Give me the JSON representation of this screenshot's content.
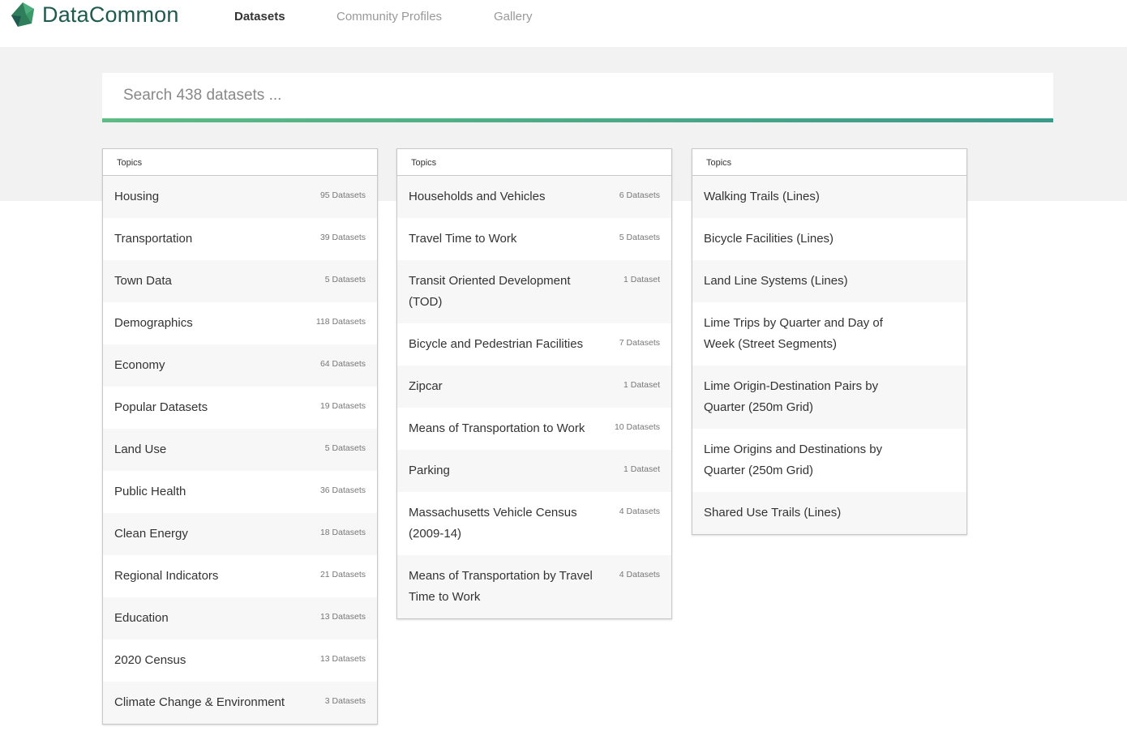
{
  "brand": {
    "name": "DataCommon",
    "colors": {
      "primary": "#1f5a4e",
      "accent": "#5cbc84"
    }
  },
  "nav": [
    {
      "label": "Datasets",
      "active": true
    },
    {
      "label": "Community Profiles",
      "active": false
    },
    {
      "label": "Gallery",
      "active": false
    }
  ],
  "search": {
    "placeholder": "Search 438 datasets ...",
    "value": ""
  },
  "panels": [
    {
      "header": "Topics",
      "items": [
        {
          "label": "Housing",
          "count": "95 Datasets"
        },
        {
          "label": "Transportation",
          "count": "39 Datasets"
        },
        {
          "label": "Town Data",
          "count": "5 Datasets"
        },
        {
          "label": "Demographics",
          "count": "118 Datasets"
        },
        {
          "label": "Economy",
          "count": "64 Datasets"
        },
        {
          "label": "Popular Datasets",
          "count": "19 Datasets"
        },
        {
          "label": "Land Use",
          "count": "5 Datasets"
        },
        {
          "label": "Public Health",
          "count": "36 Datasets"
        },
        {
          "label": "Clean Energy",
          "count": "18 Datasets"
        },
        {
          "label": "Regional Indicators",
          "count": "21 Datasets"
        },
        {
          "label": "Education",
          "count": "13 Datasets"
        },
        {
          "label": "2020 Census",
          "count": "13 Datasets"
        },
        {
          "label": "Climate Change & Environment",
          "count": "3 Datasets"
        }
      ]
    },
    {
      "header": "Topics",
      "items": [
        {
          "label": "Households and Vehicles",
          "count": "6 Datasets"
        },
        {
          "label": "Travel Time to Work",
          "count": "5 Datasets"
        },
        {
          "label": "Transit Oriented Development (TOD)",
          "count": "1 Dataset"
        },
        {
          "label": "Bicycle and Pedestrian Facilities",
          "count": "7 Datasets"
        },
        {
          "label": "Zipcar",
          "count": "1 Dataset"
        },
        {
          "label": "Means of Transportation to Work",
          "count": "10 Datasets"
        },
        {
          "label": "Parking",
          "count": "1 Dataset"
        },
        {
          "label": "Massachusetts Vehicle Census (2009-14)",
          "count": "4 Datasets"
        },
        {
          "label": "Means of Transportation by Travel Time to Work",
          "count": "4 Datasets"
        }
      ]
    },
    {
      "header": "Topics",
      "items": [
        {
          "label": "Walking Trails (Lines)",
          "count": ""
        },
        {
          "label": "Bicycle Facilities (Lines)",
          "count": ""
        },
        {
          "label": "Land Line Systems (Lines)",
          "count": ""
        },
        {
          "label": "Lime Trips by Quarter and Day of Week (Street Segments)",
          "count": ""
        },
        {
          "label": "Lime Origin-Destination Pairs by Quarter (250m Grid)",
          "count": ""
        },
        {
          "label": "Lime Origins and Destinations by Quarter (250m Grid)",
          "count": ""
        },
        {
          "label": "Shared Use Trails (Lines)",
          "count": ""
        }
      ]
    }
  ]
}
